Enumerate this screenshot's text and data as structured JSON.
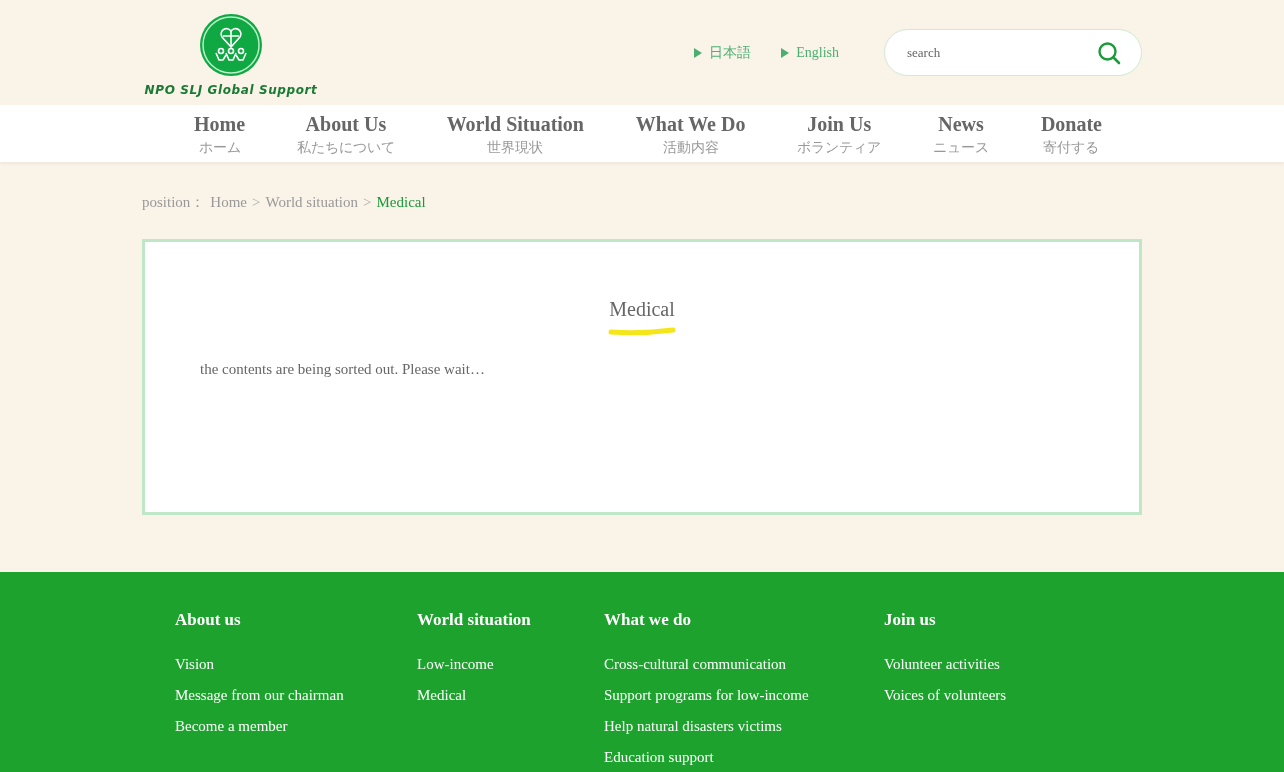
{
  "header": {
    "logo_text": "NPO SLJ Global Support",
    "languages": [
      "日本語",
      "English"
    ],
    "search": {
      "placeholder": "search"
    }
  },
  "nav": [
    {
      "label": "Home",
      "sub": "ホーム"
    },
    {
      "label": "About Us",
      "sub": "私たちについて"
    },
    {
      "label": "World Situation",
      "sub": "世界現状"
    },
    {
      "label": "What We Do",
      "sub": "活動内容"
    },
    {
      "label": "Join Us",
      "sub": "ボランティア"
    },
    {
      "label": "News",
      "sub": "ニュース"
    },
    {
      "label": "Donate",
      "sub": "寄付する"
    }
  ],
  "breadcrumb": {
    "label": "position：",
    "items": [
      {
        "kind": "link",
        "text": "Home",
        "current": false
      },
      {
        "kind": "separator",
        "text": ">"
      },
      {
        "kind": "link",
        "text": "World situation",
        "current": false
      },
      {
        "kind": "separator",
        "text": ">"
      },
      {
        "kind": "link",
        "text": "Medical",
        "current": true
      }
    ]
  },
  "content": {
    "title": "Medical",
    "body": "the contents are being sorted out. Please wait…"
  },
  "footer": [
    {
      "heading": "About us",
      "links": [
        "Vision",
        "Message from our chairman",
        "Become a member"
      ]
    },
    {
      "heading": "World situation",
      "links": [
        "Low-income",
        "Medical"
      ]
    },
    {
      "heading": "What we do",
      "links": [
        "Cross-cultural communication",
        "Support programs for low-income",
        "Help natural disasters victims",
        "Education support"
      ]
    },
    {
      "heading": "Join us",
      "links": [
        "Volunteer activities",
        "Voices of volunteers"
      ]
    }
  ]
}
